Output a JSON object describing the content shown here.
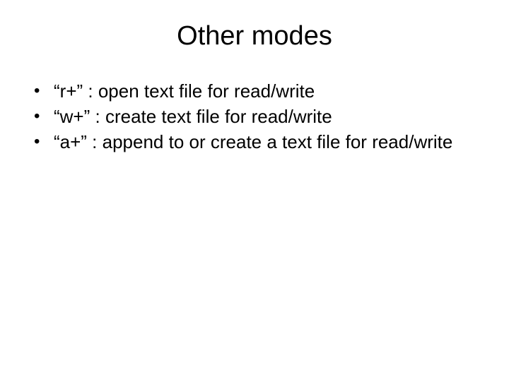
{
  "slide": {
    "title": "Other modes",
    "bullets": [
      "“r+” : open text file for read/write",
      "“w+” : create text file for read/write",
      "“a+” : append to or create a text file for read/write"
    ]
  }
}
